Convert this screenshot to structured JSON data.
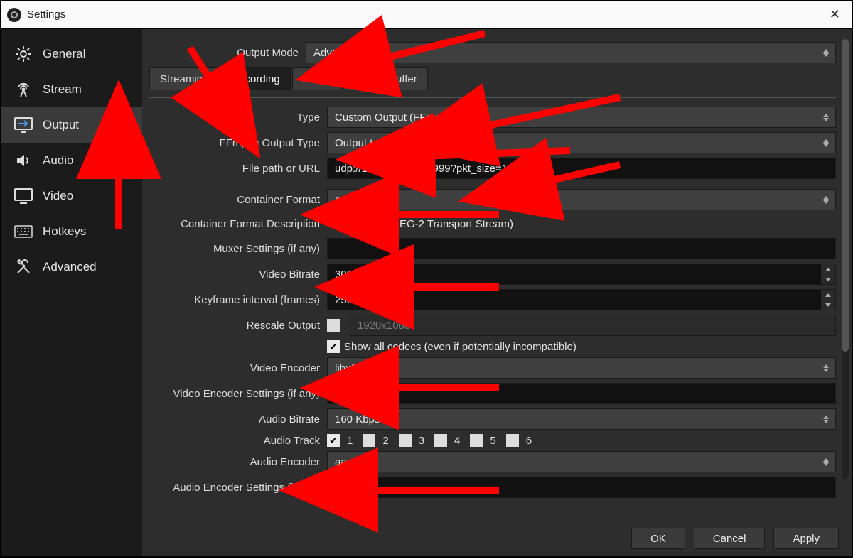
{
  "window": {
    "title": "Settings"
  },
  "sidebar": {
    "items": [
      {
        "label": "General"
      },
      {
        "label": "Stream"
      },
      {
        "label": "Output"
      },
      {
        "label": "Audio"
      },
      {
        "label": "Video"
      },
      {
        "label": "Hotkeys"
      },
      {
        "label": "Advanced"
      }
    ]
  },
  "output_mode": {
    "label": "Output Mode",
    "value": "Advanced"
  },
  "tabs": [
    {
      "label": "Streaming"
    },
    {
      "label": "Recording"
    },
    {
      "label": "Audio"
    },
    {
      "label": "Replay Buffer"
    }
  ],
  "form": {
    "type": {
      "label": "Type",
      "value": "Custom Output (FFmpeg)"
    },
    "ffmpeg_output_type": {
      "label": "FFmpeg Output Type",
      "value": "Output to URL"
    },
    "file_path": {
      "label": "File path or URL",
      "value": "udp://192.168.1.75:9999?pkt_size=1316"
    },
    "container_format": {
      "label": "Container Format",
      "value": "mpegts"
    },
    "container_desc": {
      "label": "Container Format Description",
      "value": "MPEG-TS (MPEG-2 Transport Stream)"
    },
    "muxer": {
      "label": "Muxer Settings (if any)",
      "value": ""
    },
    "video_bitrate": {
      "label": "Video Bitrate",
      "value": "3000 Kbps"
    },
    "keyframe": {
      "label": "Keyframe interval (frames)",
      "value": "250"
    },
    "rescale": {
      "label": "Rescale Output",
      "placeholder": "1920x1080",
      "checked": false
    },
    "show_codecs": {
      "label": "Show all codecs (even if potentially incompatible)",
      "checked": true
    },
    "video_encoder": {
      "label": "Video Encoder",
      "value": "libx264"
    },
    "video_enc_settings": {
      "label": "Video Encoder Settings (if any)",
      "value": ""
    },
    "audio_bitrate": {
      "label": "Audio Bitrate",
      "value": "160 Kbps"
    },
    "audio_track": {
      "label": "Audio Track",
      "tracks": [
        "1",
        "2",
        "3",
        "4",
        "5",
        "6"
      ],
      "checked": [
        true,
        false,
        false,
        false,
        false,
        false
      ]
    },
    "audio_encoder": {
      "label": "Audio Encoder",
      "value": "aac"
    },
    "audio_enc_settings": {
      "label": "Audio Encoder Settings (if any)",
      "value": ""
    }
  },
  "footer": {
    "ok": "OK",
    "cancel": "Cancel",
    "apply": "Apply"
  }
}
